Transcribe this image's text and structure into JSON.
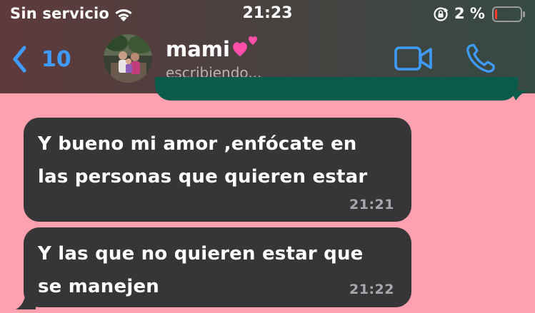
{
  "status_bar": {
    "carrier": "Sin servicio",
    "time": "21:23",
    "battery_percent": "2 %",
    "battery_level": 0.02,
    "wifi_icon": "wifi-icon",
    "lock_icon": "orientation-lock-icon"
  },
  "header": {
    "back_count": "10",
    "contact_name": "mami",
    "contact_emoji": "two-hearts-icon",
    "contact_status": "escribiendo...",
    "accent_color": "#3f9cff",
    "icons": [
      "back-chevron-icon",
      "video-camera-icon",
      "phone-icon"
    ]
  },
  "messages": [
    {
      "direction": "incoming",
      "lines": [
        "Y bueno mi amor ,enfócate en",
        "las personas que quieren estar"
      ],
      "time": "21:21"
    },
    {
      "direction": "incoming",
      "lines": [
        "Y las que no quieren estar que",
        "se manejen"
      ],
      "time": "21:22"
    }
  ],
  "colors": {
    "chat_background": "#fda1ae",
    "incoming_bubble": "#363638",
    "outgoing_bubble": "#0b5b4d"
  }
}
